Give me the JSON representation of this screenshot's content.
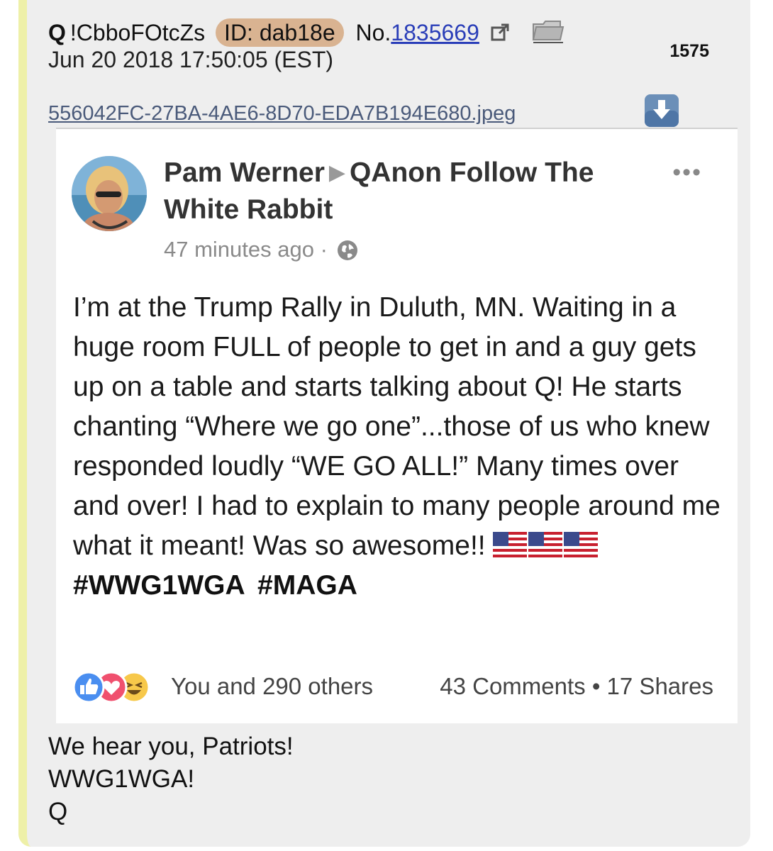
{
  "post": {
    "name": "Q",
    "tripcode": "!CbboFOtcZs",
    "id_label": "ID: dab18e",
    "no_prefix": "No.",
    "no_value": "1835669",
    "date": "Jun 20 2018 17:50:05 (EST)",
    "count": "1575",
    "filename": "556042FC-27BA-4AE6-8D70-EDA7B194E680.jpeg",
    "message_lines": [
      "We hear you, Patriots!",
      "WWG1WGA!",
      "Q"
    ]
  },
  "fb": {
    "author": "Pam Werner",
    "group": "QAnon Follow The White Rabbit",
    "more": "•••",
    "time": "47 minutes ago",
    "time_sep": "·",
    "body": "I’m at the Trump Rally in Duluth, MN. Waiting in a huge room FULL of people to get in and a guy gets up on a table and starts talking about Q! He starts chanting “Where we go one”...those of us who knew responded loudly “WE GO ALL!” Many times over and over! I had to explain to many people around me what it meant! Was so awesome!! ",
    "hashtags": "#WWG1WGA #MAGA",
    "likes": "You and 290 others",
    "stats": "43 Comments • 17 Shares"
  },
  "icons": {
    "external_link": "external-link-icon",
    "folder": "folder-icon",
    "download": "download-icon",
    "globe": "globe-icon",
    "flag": "us-flag-icon",
    "like": "like-reaction-icon",
    "love": "love-reaction-icon",
    "haha": "haha-reaction-icon"
  },
  "colors": {
    "post_bg": "#eeeeee",
    "post_border": "#eef0a8",
    "id_badge": "#d9b391",
    "link": "#2a3eb8",
    "download_btn": "#6b8fb8",
    "fb_like": "#4a8ef0",
    "fb_love": "#f0506e",
    "fb_haha": "#f7c84a"
  }
}
